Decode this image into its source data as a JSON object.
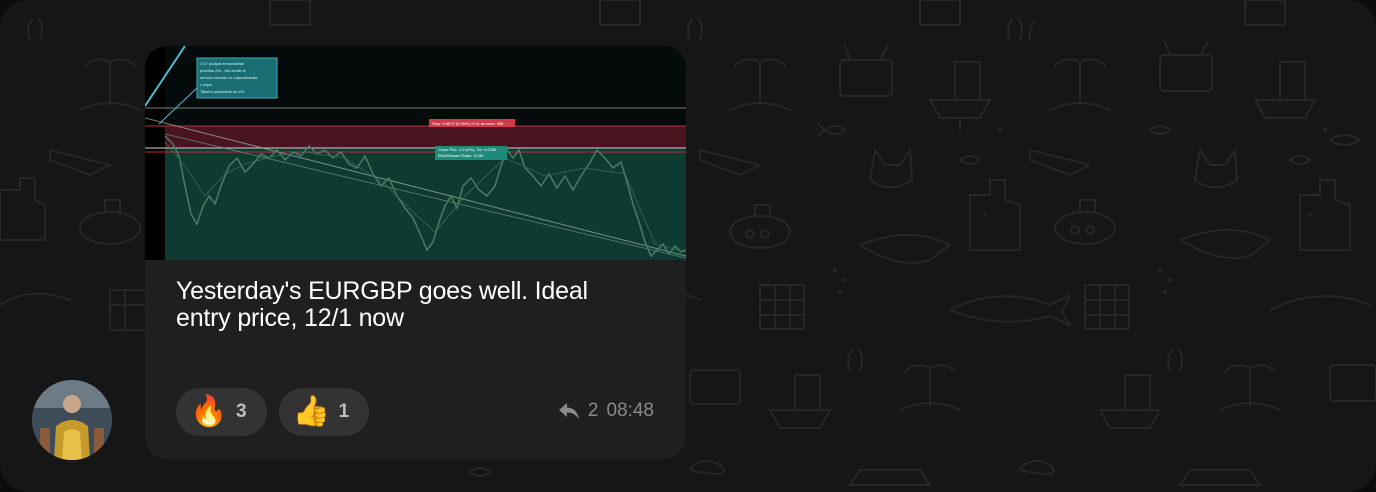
{
  "message": {
    "text": "Yesterday's EURGBP goes well. Ideal entry price, 12/1 now",
    "reactions": [
      {
        "emoji": "🔥",
        "icon": "fire-emoji",
        "count": "3"
      },
      {
        "emoji": "👍",
        "icon": "thumbs-up-emoji",
        "count": "1"
      }
    ],
    "replies": "2",
    "time": "08:48",
    "image": {
      "note_lines": [
        "1:1? podpat zmarnatelan",
        "prioritas 6% - kto zmaki si",
        "nemozi zravatu vo zaprocitovata",
        "z dojm",
        "Taksha podavanik su 6%"
      ],
      "stop_label": "Stop: 0.8870 (0.30%) 21.6, Amount: 398",
      "target_label_1": "Close P&L: 2.6 (0%), Tar: 0.0789",
      "target_label_2": "Risk/Reward Ratio: 12.85"
    }
  },
  "colors": {
    "background": "#161616",
    "bubble": "#1f1f1f",
    "reaction_pill": "#333333",
    "chart_profit_zone": "#0f3a32",
    "chart_loss_zone": "#4a1520"
  }
}
